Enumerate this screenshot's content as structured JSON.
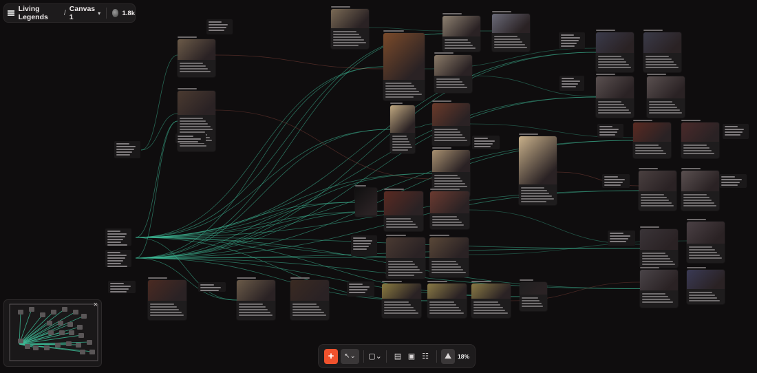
{
  "header": {
    "project": "Living Legends",
    "separator": "/",
    "canvas": "Canvas 1",
    "collaborators_count": "1.8k",
    "icons": [
      "menu-icon",
      "chevron-down-icon",
      "avatar"
    ]
  },
  "minimap": {
    "close_label": "×"
  },
  "toolbar": {
    "add_label": "+",
    "select_label": "↖⌄",
    "sticky_label": "▢⌄",
    "document_label": "▤",
    "image_label": "▣",
    "layout_label": "☷",
    "map_label": "⛰",
    "zoom_level": "18%"
  },
  "colors": {
    "background": "#0f0d0e",
    "node": "#1e1c1d",
    "edge_primary": "#3fbf9a",
    "edge_secondary": "#b0574a",
    "accent": "#f0522d"
  }
}
